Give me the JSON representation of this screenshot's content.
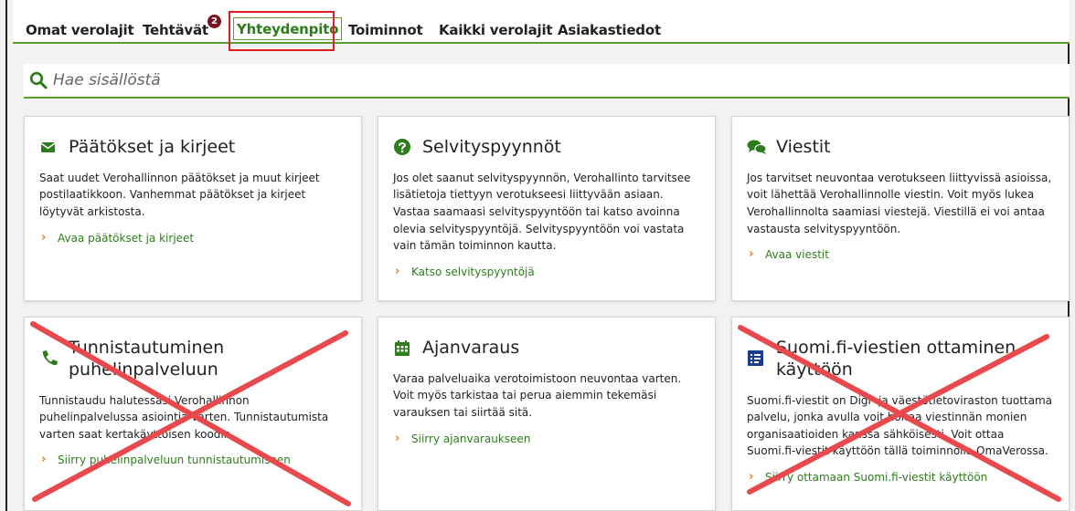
{
  "tabs": [
    {
      "label": "Omat verolajit"
    },
    {
      "label": "Tehtävät",
      "badge": "2"
    },
    {
      "label": "Yhteydenpito",
      "active": true
    },
    {
      "label": "Toiminnot"
    },
    {
      "label": "Kaikki verolajit"
    },
    {
      "label": "Asiakastiedot"
    }
  ],
  "search": {
    "placeholder": "Hae sisällöstä",
    "icon": "search-icon"
  },
  "cards": [
    {
      "icon": "envelope-icon",
      "title": "Päätökset ja kirjeet",
      "text": "Saat uudet Verohallinnon päätökset ja muut kirjeet postilaatikkoon. Vanhemmat päätökset ja kirjeet löytyvät arkistosta.",
      "link": "Avaa päätökset ja kirjeet"
    },
    {
      "icon": "question-circle-icon",
      "title": "Selvityspyynnöt",
      "text": "Jos olet saanut selvityspyynnön, Verohallinto tarvitsee lisätietoja tiettyyn verotukseesi liittyvään asiaan. Vastaa saamaasi selvityspyyntöön tai katso avoinna olevia selvityspyyntöjä. Selvityspyyntöön voi vastata vain tämän toiminnon kautta.",
      "link": "Katso selvityspyyntöjä"
    },
    {
      "icon": "chat-bubbles-icon",
      "title": "Viestit",
      "text": "Jos tarvitset neuvontaa verotukseen liittyvissä asioissa, voit lähettää Verohallinnolle viestin. Voit myös lukea Verohallinnolta saamiasi viestejä. Viestillä ei voi antaa vastausta selvityspyyntöön.",
      "link": "Avaa viestit"
    },
    {
      "icon": "phone-icon",
      "title": "Tunnistautuminen puhelinpalveluun",
      "text": "Tunnistaudu halutessasi Verohallinnon puhelinpalvelussa asiointia varten. Tunnistautumista varten saat kertakäyttöisen koodin.",
      "link": "Siirry puhelinpalveluun tunnistautumiseen",
      "crossed": true
    },
    {
      "icon": "calendar-icon",
      "title": "Ajanvaraus",
      "text": "Varaa palveluaika verotoimistoon neuvontaa varten. Voit myös tarkistaa tai perua aiemmin tekemäsi varauksen tai siirtää sitä.",
      "link": "Siirry ajanvaraukseen"
    },
    {
      "icon": "message-list-icon",
      "title": "Suomi.fi-viestien ottaminen käyttöön",
      "text": "Suomi.fi-viestit on Digi- ja väestötietoviraston tuottama palvelu, jonka avulla voit hoitaa viestinnän monien organisaatioiden kanssa sähköisesti. Voit ottaa Suomi.fi-viestit käyttöön tällä toiminnolla OmaVerossa.",
      "link": "Siirry ottamaan Suomi.fi-viestit käyttöön",
      "crossed": true
    }
  ],
  "colors": {
    "accent": "#5a9d33",
    "link": "#2e7d1d",
    "highlight": "#e02020",
    "cross": "#e8494d",
    "chevron": "#e07b1a"
  }
}
